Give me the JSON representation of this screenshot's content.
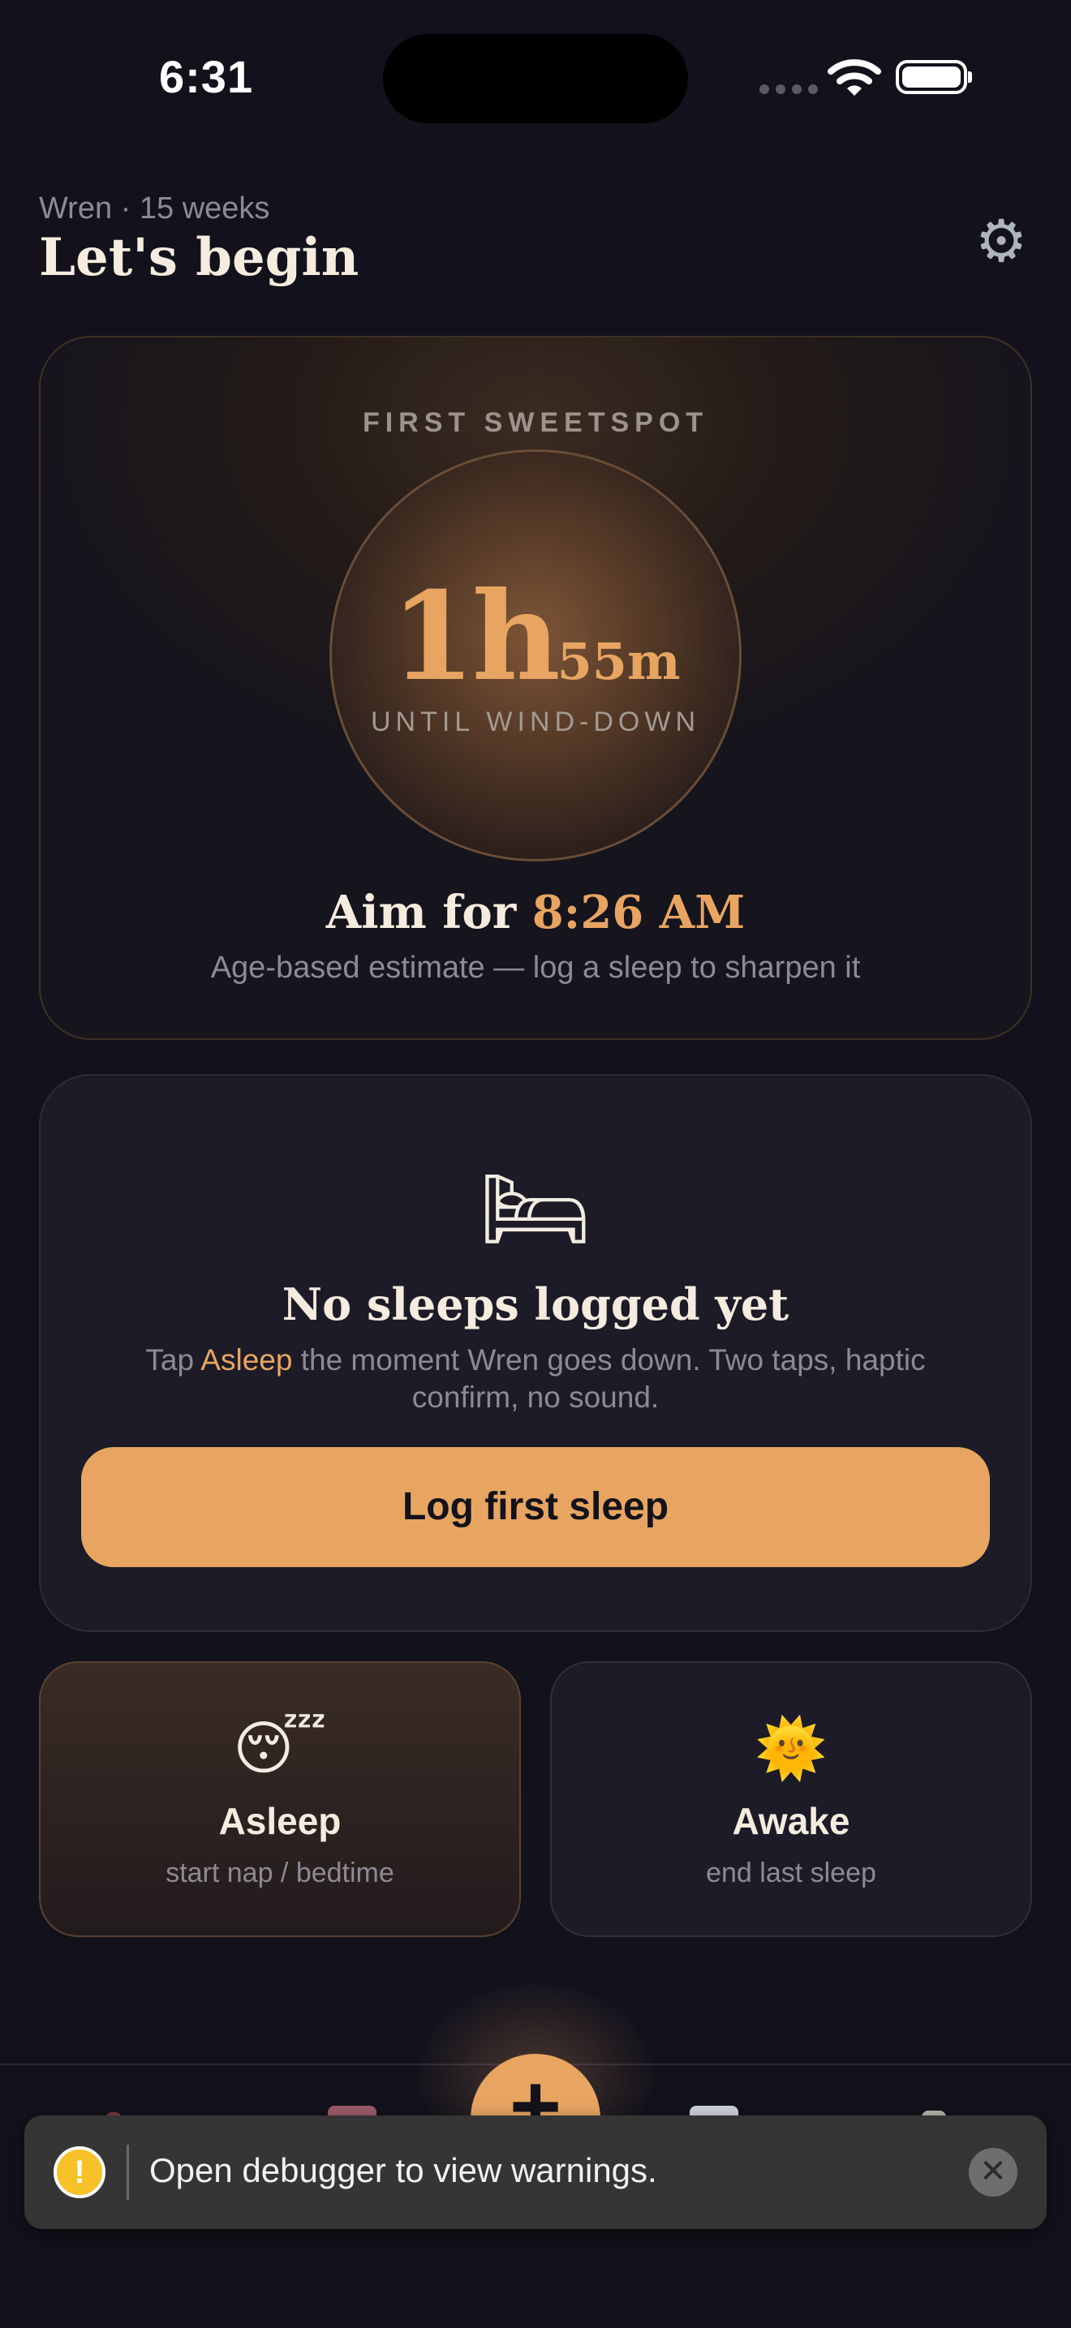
{
  "status_bar": {
    "time": "6:31"
  },
  "header": {
    "subtitle": "Wren · 15 weeks",
    "title": "Let's begin",
    "settings_icon": "gear-icon"
  },
  "sweetspot": {
    "label": "FIRST SWEETSPOT",
    "hours": "1h",
    "minutes": "55m",
    "caption": "UNTIL WIND-DOWN",
    "aim_prefix": "Aim for",
    "aim_time": "8:26 AM",
    "note": "Age-based estimate — log a sleep to sharpen it",
    "accent_color": "#e8a562"
  },
  "empty_state": {
    "icon": "bed-icon",
    "title": "No sleeps logged yet",
    "text_before": "Tap",
    "text_highlight": "Asleep",
    "text_after": "the moment Wren goes down. Two taps, haptic confirm, no sound.",
    "button_label": "Log first sleep"
  },
  "actions": [
    {
      "icon": "sleepy-face-icon",
      "title": "Asleep",
      "subtitle": "start nap / bedtime"
    },
    {
      "icon": "sun-icon",
      "title": "Awake",
      "subtitle": "end last sleep"
    }
  ],
  "tab_bar": {
    "fab_label": "+"
  },
  "toast": {
    "message": "Open debugger to view warnings.",
    "warning_icon": "warning-icon",
    "close_icon": "close-icon"
  }
}
